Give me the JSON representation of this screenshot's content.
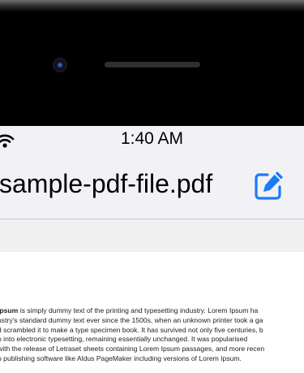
{
  "status_bar": {
    "time": "1:40 AM"
  },
  "nav": {
    "title": "sample-pdf-file.pdf",
    "edit_icon": "edit-icon"
  },
  "document": {
    "bold_lead": "Ipsum",
    "lines": [
      " is simply dummy text of the printing and typesetting industry. Lorem Ipsum ha",
      "ustry's standard dummy text ever since the 1500s, when an unknown printer took a ga",
      "d scrambled it to make a type specimen book. It has survived not only five centuries, b",
      "p into electronic typesetting, remaining essentially unchanged. It was popularised",
      "with the release of Letraset sheets containing Lorem Ipsum passages, and more recen",
      "o publishing software like Aldus PageMaker including versions of Lorem Ipsum."
    ]
  }
}
